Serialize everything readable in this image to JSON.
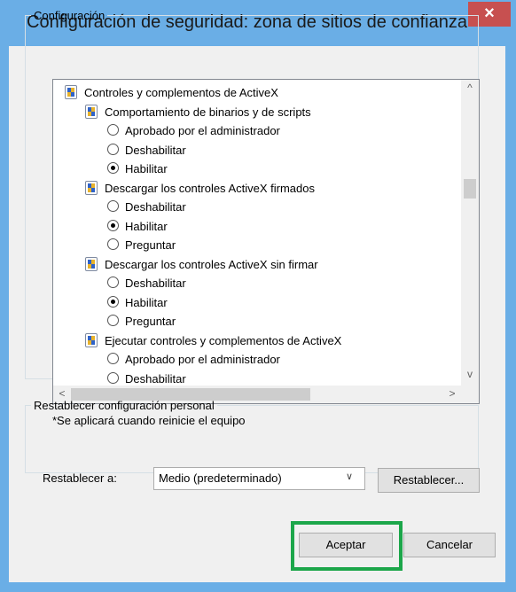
{
  "dialog": {
    "title": "Configuración de seguridad: zona de sitios de confianza",
    "close_glyph": "×"
  },
  "settings": {
    "legend": "Configuración",
    "tree": [
      {
        "kind": "category",
        "label": "Controles y complementos de ActiveX",
        "icon": "shield-icon"
      },
      {
        "kind": "setting",
        "label": "Comportamiento de binarios y de scripts",
        "icon": "shield-icon"
      },
      {
        "kind": "option",
        "label": "Aprobado por el administrador",
        "checked": false
      },
      {
        "kind": "option",
        "label": "Deshabilitar",
        "checked": false
      },
      {
        "kind": "option",
        "label": "Habilitar",
        "checked": true
      },
      {
        "kind": "setting",
        "label": "Descargar los controles ActiveX firmados",
        "icon": "shield-icon"
      },
      {
        "kind": "option",
        "label": "Deshabilitar",
        "checked": false
      },
      {
        "kind": "option",
        "label": "Habilitar",
        "checked": true
      },
      {
        "kind": "option",
        "label": "Preguntar",
        "checked": false
      },
      {
        "kind": "setting",
        "label": "Descargar los controles ActiveX sin firmar",
        "icon": "shield-icon"
      },
      {
        "kind": "option",
        "label": "Deshabilitar",
        "checked": false
      },
      {
        "kind": "option",
        "label": "Habilitar",
        "checked": true
      },
      {
        "kind": "option",
        "label": "Preguntar",
        "checked": false
      },
      {
        "kind": "setting",
        "label": "Ejecutar controles y complementos de ActiveX",
        "icon": "shield-icon"
      },
      {
        "kind": "option",
        "label": "Aprobado por el administrador",
        "checked": false
      },
      {
        "kind": "option",
        "label": "Deshabilitar",
        "checked": false
      }
    ],
    "scroll_up": "^",
    "scroll_down": "v",
    "scroll_left": "<",
    "scroll_right": ">",
    "note": "*Se aplicará cuando reinicie el equipo"
  },
  "reset": {
    "legend": "Restablecer configuración personal",
    "label": "Restablecer a:",
    "selected": "Medio (predeterminado)",
    "button": "Restablecer..."
  },
  "footer": {
    "accept": "Aceptar",
    "cancel": "Cancelar",
    "highlight_color": "#1ca64a"
  }
}
